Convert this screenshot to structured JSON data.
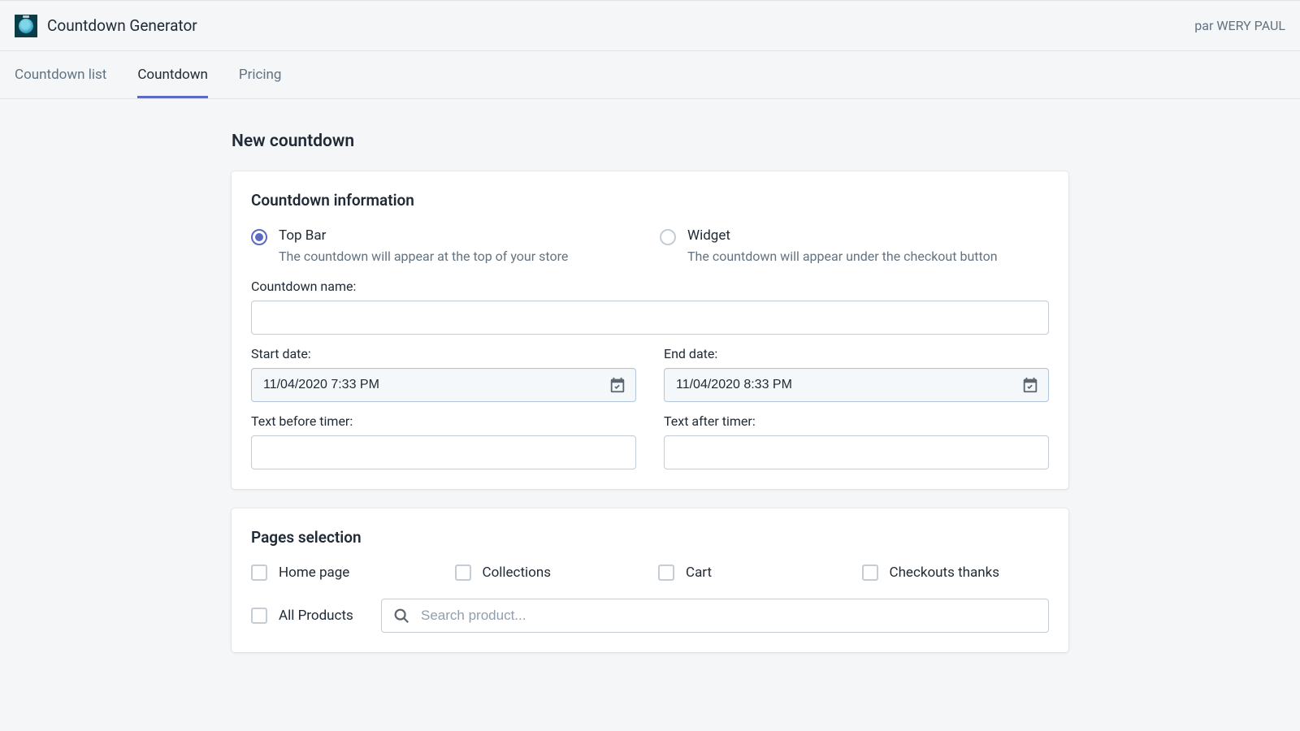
{
  "header": {
    "app_title": "Countdown Generator",
    "user_text": "par WERY PAUL"
  },
  "tabs": [
    {
      "label": "Countdown list"
    },
    {
      "label": "Countdown"
    },
    {
      "label": "Pricing"
    }
  ],
  "active_tab_index": 1,
  "page_title": "New countdown",
  "card_info": {
    "title": "Countdown information",
    "radio_topbar_label": "Top Bar",
    "radio_topbar_desc": "The countdown will appear at the top of your store",
    "radio_widget_label": "Widget",
    "radio_widget_desc": "The countdown will appear under the checkout button",
    "countdown_name_label": "Countdown name:",
    "countdown_name_value": "",
    "start_date_label": "Start date:",
    "start_date_value": "11/04/2020 7:33 PM",
    "end_date_label": "End date:",
    "end_date_value": "11/04/2020 8:33 PM",
    "text_before_label": "Text before timer:",
    "text_before_value": "",
    "text_after_label": "Text after timer:",
    "text_after_value": ""
  },
  "card_pages": {
    "title": "Pages selection",
    "home_label": "Home page",
    "collections_label": "Collections",
    "cart_label": "Cart",
    "checkouts_label": "Checkouts thanks",
    "all_products_label": "All Products",
    "search_placeholder": "Search product..."
  },
  "colors": {
    "accent": "#5c6ac4"
  }
}
